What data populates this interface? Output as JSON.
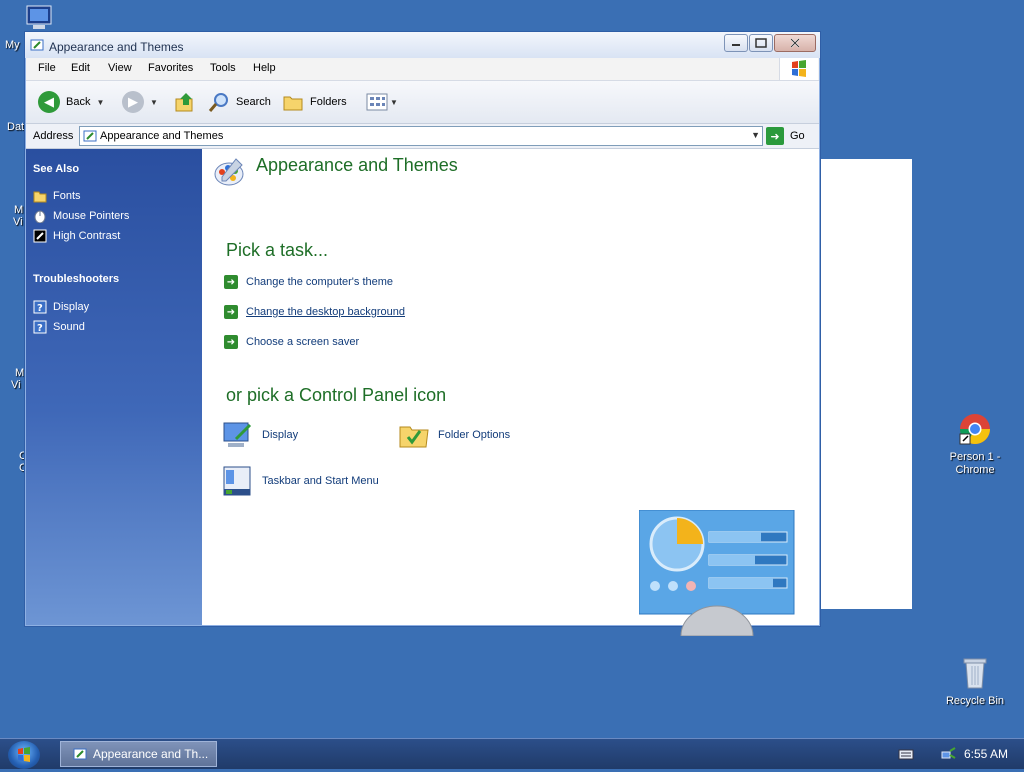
{
  "desktop": {
    "left_fragments": [
      "My",
      "Dat",
      "M",
      "Vi",
      "M",
      "Vi",
      "C",
      "C"
    ],
    "chrome_label": "Person 1 - Chrome",
    "recycle_label": "Recycle Bin"
  },
  "window": {
    "title": "Appearance and Themes",
    "menu": [
      "File",
      "Edit",
      "View",
      "Favorites",
      "Tools",
      "Help"
    ],
    "toolbar": {
      "back": "Back",
      "search": "Search",
      "folders": "Folders"
    },
    "address": {
      "label": "Address",
      "value": "Appearance and Themes",
      "go": "Go"
    },
    "sidebar": {
      "see_also_title": "See Also",
      "see_also": [
        {
          "label": "Fonts",
          "icon": "folder-icon"
        },
        {
          "label": "Mouse Pointers",
          "icon": "mouse-icon"
        },
        {
          "label": "High Contrast",
          "icon": "contrast-icon"
        }
      ],
      "troubleshooters_title": "Troubleshooters",
      "troubleshooters": [
        {
          "label": "Display",
          "icon": "help-icon"
        },
        {
          "label": "Sound",
          "icon": "help-icon"
        }
      ]
    },
    "content": {
      "title": "Appearance and Themes",
      "pick_task": "Pick a task...",
      "tasks": [
        "Change the computer's theme",
        "Change the desktop background",
        "Choose a screen saver"
      ],
      "pick_icon": "or pick a Control Panel icon",
      "icons": [
        {
          "label": "Display",
          "icon": "display-icon"
        },
        {
          "label": "Folder Options",
          "icon": "folder-options-icon"
        },
        {
          "label": "Taskbar and Start Menu",
          "icon": "taskbar-icon"
        }
      ]
    }
  },
  "taskbar": {
    "active_task": "Appearance and Th...",
    "clock": "6:55 AM"
  },
  "colors": {
    "desktop": "#3a6fb4",
    "heading_green": "#1e6e27",
    "link_blue": "#123c7a",
    "sidebar_top": "#2a4fa0"
  }
}
